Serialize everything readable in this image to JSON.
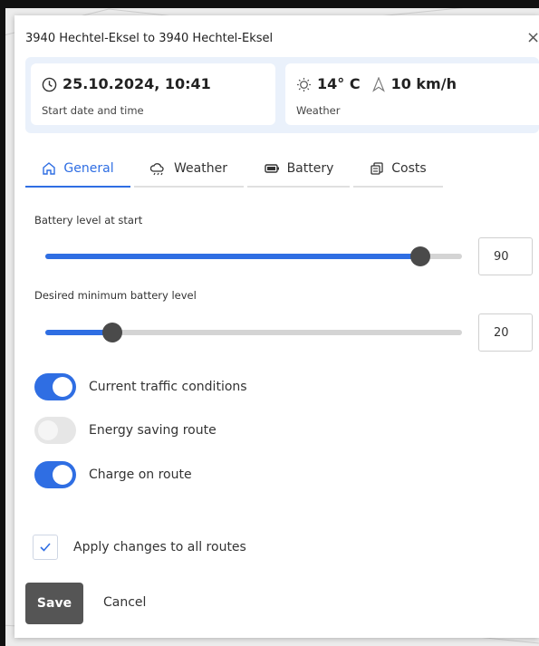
{
  "dialog": {
    "title": "3940 Hechtel-Eksel to 3940 Hechtel-Eksel",
    "close_glyph": "×"
  },
  "start": {
    "icon": "clock-icon",
    "value": "25.10.2024, 10:41",
    "label": "Start date and time"
  },
  "weather": {
    "temp_icon": "sun-icon",
    "temperature": "14° C",
    "wind_icon": "wind-direction-icon",
    "wind": "10 km/h",
    "label": "Weather"
  },
  "tabs": [
    {
      "label": "General",
      "icon": "home-icon",
      "active": true
    },
    {
      "label": "Weather",
      "icon": "weather-icon",
      "active": false
    },
    {
      "label": "Battery",
      "icon": "battery-icon",
      "active": false
    },
    {
      "label": "Costs",
      "icon": "coins-icon",
      "active": false
    }
  ],
  "battery_start": {
    "label": "Battery level at start",
    "value": "90",
    "slider_fraction": 0.9
  },
  "battery_min": {
    "label": "Desired minimum battery level",
    "value": "20",
    "slider_fraction": 0.16
  },
  "toggles": [
    {
      "label": "Current traffic conditions",
      "on": true
    },
    {
      "label": "Energy saving route",
      "on": false
    },
    {
      "label": "Charge on route",
      "on": true
    }
  ],
  "apply_all": {
    "label": "Apply changes to all routes",
    "checked": true
  },
  "buttons": {
    "save": "Save",
    "cancel": "Cancel"
  },
  "colors": {
    "accent": "#2f6ee3",
    "save_button": "#555555",
    "info_strip": "#eaf1fb"
  }
}
